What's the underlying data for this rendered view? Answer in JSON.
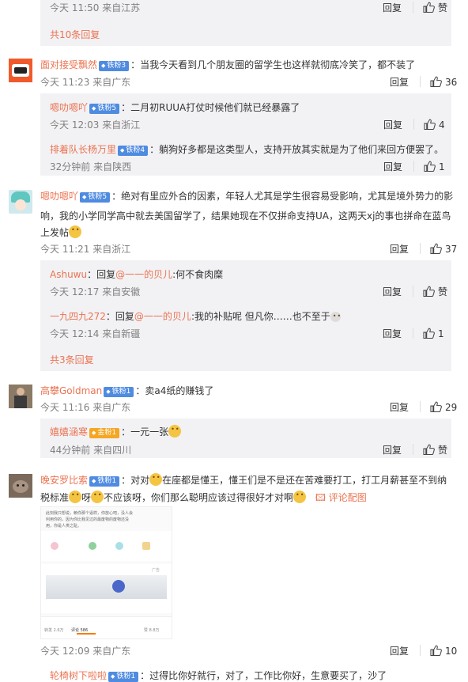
{
  "icons": {
    "like": "thumb-up-icon",
    "reply": "reply-label",
    "emoji": "emoji-face-icon",
    "pic": "image-icon"
  },
  "top": {
    "time": "今天 11:50 来自江苏",
    "reply": "回复",
    "like": "赞",
    "more_link": "共10条回复"
  },
  "c1": {
    "user": "面对接受飘然",
    "badge": "铁粉3",
    "text": "：当我今天看到几个朋友圈的留学生也这样就彻底冷笑了，都不装了",
    "time": "今天 11:23 来自广东",
    "reply": "回复",
    "likes": "36",
    "replies": [
      {
        "user": "嗯叻嗯吖",
        "badge": "铁粉5",
        "text": "：二月初RUUA打仗时候他们就已经暴露了",
        "time": "今天 12:03 来自浙江",
        "reply": "回复",
        "likes": "4"
      },
      {
        "user": "排着队长杨万里",
        "badge": "铁粉4",
        "text": "：躺狗好多都是这类型人，支持开放其实就是为了他们来回方便罢了。",
        "time": "32分钟前 来自陕西",
        "reply": "回复",
        "likes": "1"
      }
    ]
  },
  "c2": {
    "user": "嗯叻嗯吖",
    "badge": "铁粉5",
    "line1": "：绝对有里应外合的因素，年轻人尤其是学生很容易受影响，尤其是境外势力的影",
    "line2": "响，我的小学同学高中就去美国留学了，结果她现在不仅拼命支持UA，这两天xj的事也拼命在蓝鸟",
    "line3": "上发帖",
    "time": "今天 11:21 来自浙江",
    "reply": "回复",
    "likes": "37",
    "replies": [
      {
        "user": "Ashuwu",
        "prefix": "：回复",
        "mention": "@一一的贝儿",
        "text": ":何不食肉糜",
        "time": "今天 12:17 来自安徽",
        "reply": "回复",
        "like": "赞"
      },
      {
        "user": "一九四九272",
        "prefix": "：回复",
        "mention": "@一一的贝儿",
        "text": ":我的补贴呢 但凡你……也不至于",
        "time": "今天 12:14 来自新疆",
        "reply": "回复",
        "likes": "1"
      }
    ],
    "more_link": "共3条回复"
  },
  "c3": {
    "user": "高攀Goldman",
    "badge": "铁粉1",
    "text": "：卖a4纸的赚钱了",
    "time": "今天 11:16 来自广东",
    "reply": "回复",
    "likes": "29",
    "replies": [
      {
        "user": "嬉嬉涵寒",
        "badge": "金粉1",
        "text": "：一元一张",
        "time": "44分钟前 来自四川",
        "reply": "回复",
        "like": "赞"
      }
    ]
  },
  "c4": {
    "user": "晚安罗比索",
    "badge": "铁粉1",
    "line1a": "：对对",
    "line1b": "在座都是懂王，懂王们是不是还在苦难要打工，打工月薪甚至不到纳",
    "line2a": "税标准",
    "line2b": "呀",
    "line2c": "不应该呀，你们那么聪明应该过得很好才对啊",
    "pic_link": "评论配图",
    "shot_text1": "此刻我只想说，赖你那个逼样，你放心吧，没人会",
    "shot_text2": "利用你的，因为你比我见过的最废物的废物还没",
    "shot_text3": "用，你是人类之耻。",
    "shot_ad": "广告",
    "shot_bar": {
      "forward": "转发 2.6万",
      "comment": "评论 586",
      "like": "赞 8.8万"
    },
    "time": "今天 12:09 来自广东",
    "reply": "回复",
    "likes": "10"
  },
  "c5": {
    "user": "轮椅树下啦啦",
    "badge": "铁粉1",
    "text": "：过得比你好就行，对了，工作比你好，生意要买了，沙了"
  }
}
